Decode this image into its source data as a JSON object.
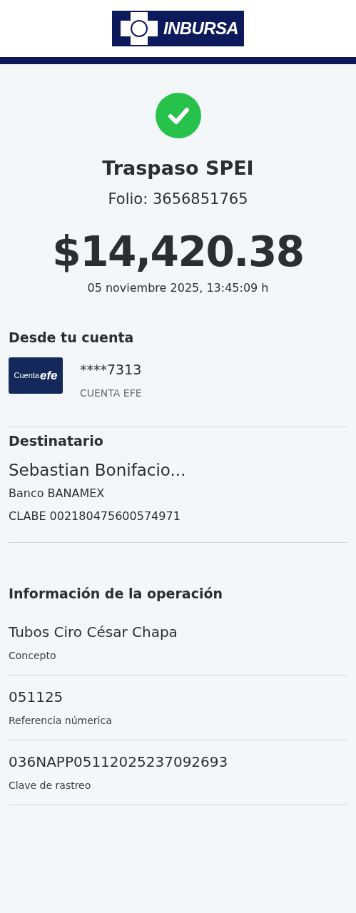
{
  "header": {
    "logo_text": "INBURSA"
  },
  "status": {
    "title": "Traspaso SPEI",
    "folio": "Folio: 3656851765"
  },
  "amount": "$14,420.38",
  "datetime": "05 noviembre 2025, 13:45:09 h",
  "source": {
    "heading": "Desde tu cuenta",
    "card_label": "Cuenta",
    "card_brand": "efe",
    "account": "****7313",
    "account_type": "CUENTA EFE"
  },
  "recipient": {
    "heading": "Destinatario",
    "name": "Sebastian Bonifacio...",
    "bank": "Banco BANAMEX",
    "clabe": "CLABE 002180475600574971"
  },
  "operation": {
    "heading": "Información de la operación",
    "items": [
      {
        "value": "Tubos Ciro César Chapa",
        "label": "Concepto"
      },
      {
        "value": "051125",
        "label": "Referencia númerica"
      },
      {
        "value": "036NAPP05112025237092693",
        "label": "Clave de rastreo"
      }
    ]
  }
}
